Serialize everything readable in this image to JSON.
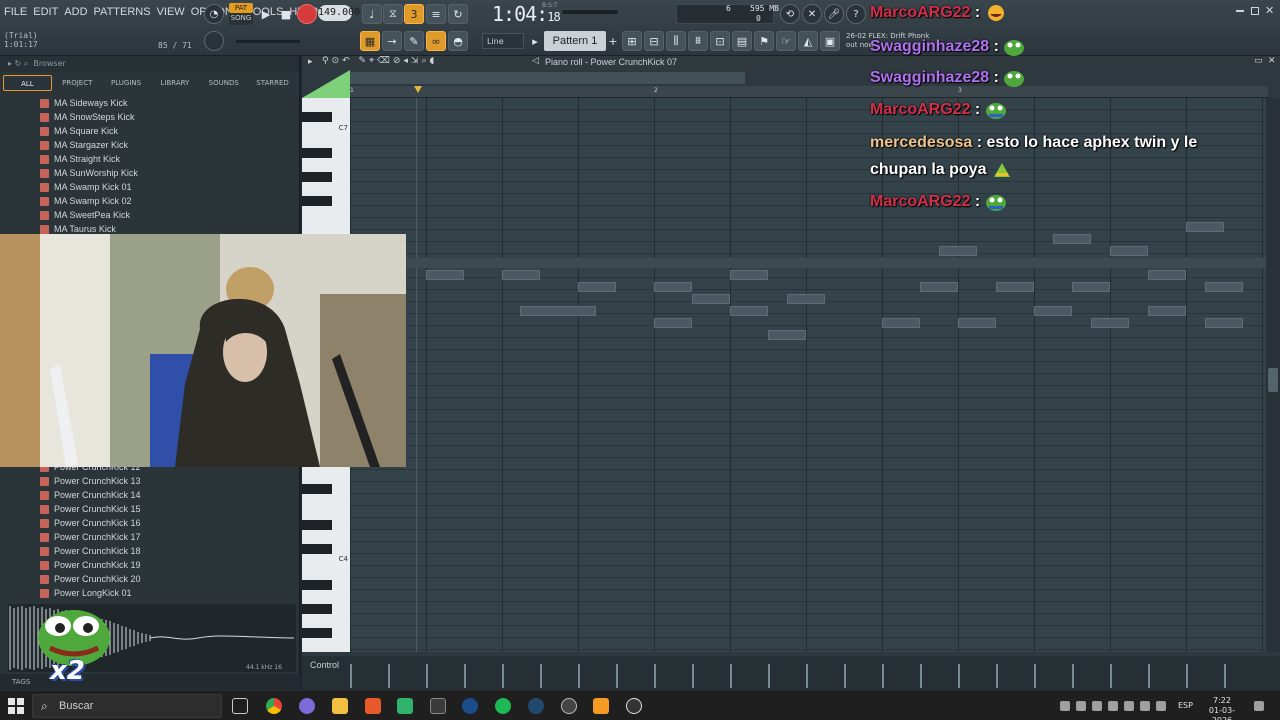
{
  "menu": [
    "FILE",
    "EDIT",
    "ADD",
    "PATTERNS",
    "VIEW",
    "OPTIONS",
    "TOOLS",
    "HELP"
  ],
  "hint": {
    "line1": "(Trial)",
    "line2": "1:01:17",
    "right": "85 / 71"
  },
  "transport": {
    "pat_label": "PAT",
    "song_label": "SONG",
    "tempo": "149.000"
  },
  "clock": {
    "main": "1:04",
    "sub": "18",
    "unit": "B:S:T"
  },
  "cpu": {
    "a": "6",
    "b": "595 MB",
    "c": "0"
  },
  "pattern": {
    "name": "Pattern 1",
    "tool_mode": "Line"
  },
  "news": {
    "line1": "26-02 FLEX: Drift Phonk",
    "line2": "out now"
  },
  "browser": {
    "header": "Browser",
    "tabs": [
      "ALL",
      "PROJECT",
      "PLUGINS",
      "LIBRARY",
      "SOUNDS",
      "STARRED"
    ],
    "top_items": [
      "MA Sideways Kick",
      "MA SnowSteps Kick",
      "MA Square Kick",
      "MA Stargazer Kick",
      "MA Straight Kick",
      "MA SunWorship Kick",
      "MA Swamp Kick 01",
      "MA Swamp Kick 02",
      "MA SweetPea Kick",
      "MA Taurus Kick"
    ],
    "bottom_items": [
      "Power CrunchKick 12",
      "Power CrunchKick 13",
      "Power CrunchKick 14",
      "Power CrunchKick 15",
      "Power CrunchKick 16",
      "Power CrunchKick 17",
      "Power CrunchKick 18",
      "Power CrunchKick 19",
      "Power CrunchKick 20",
      "Power LongKick 01"
    ],
    "wave_info": "44.1 kHz 16",
    "tags": "TAGS"
  },
  "badge": {
    "text": "x2"
  },
  "piano_roll": {
    "title": "Piano roll - Power CrunchKick 07",
    "key_labels": [
      "C7",
      "C4"
    ],
    "ruler_marks": [
      "1",
      "2",
      "3"
    ],
    "control_label": "Control"
  },
  "chat": [
    {
      "user": "MarcoARG22",
      "color": "red",
      "text": "",
      "emote": "laugh"
    },
    {
      "user": "Swagginhaze28",
      "color": "purple",
      "text": "",
      "emote": "pepe-bong"
    },
    {
      "user": "Swagginhaze28",
      "color": "purple",
      "text": "",
      "emote": "pepe-bong"
    },
    {
      "user": "MarcoARG22",
      "color": "red",
      "text": "",
      "emote": "pepe"
    },
    {
      "user": "mercedesosa",
      "color": "gold",
      "text": "esto lo hace aphex twin y le",
      "emote": ""
    },
    {
      "user": "",
      "color": "",
      "text": "chupan la poya",
      "emote": "cone"
    },
    {
      "user": "MarcoARG22",
      "color": "red",
      "text": "",
      "emote": "pepe"
    }
  ],
  "taskbar": {
    "search_placeholder": "Buscar",
    "lang": "ESP",
    "time": "7:22",
    "date": "01-03-2026"
  }
}
